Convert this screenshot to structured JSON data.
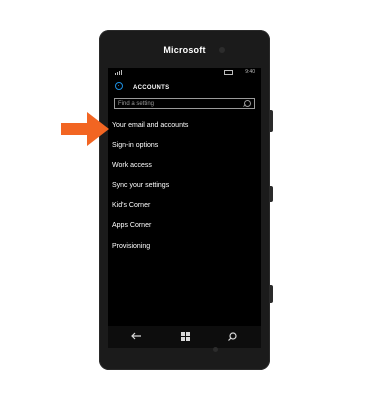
{
  "device": {
    "brand": "Microsoft"
  },
  "status_bar": {
    "time": "9:40"
  },
  "header": {
    "title": "ACCOUNTS"
  },
  "search": {
    "placeholder": "Find a setting"
  },
  "menu": {
    "items": [
      {
        "label": "Your email and accounts"
      },
      {
        "label": "Sign-in options"
      },
      {
        "label": "Work access"
      },
      {
        "label": "Sync your settings"
      },
      {
        "label": "Kid's Corner"
      },
      {
        "label": "Apps Corner"
      },
      {
        "label": "Provisioning"
      }
    ]
  },
  "highlight": {
    "target": "Your email and accounts",
    "color": "#f26522"
  },
  "accent_color": "#1d8fe0"
}
